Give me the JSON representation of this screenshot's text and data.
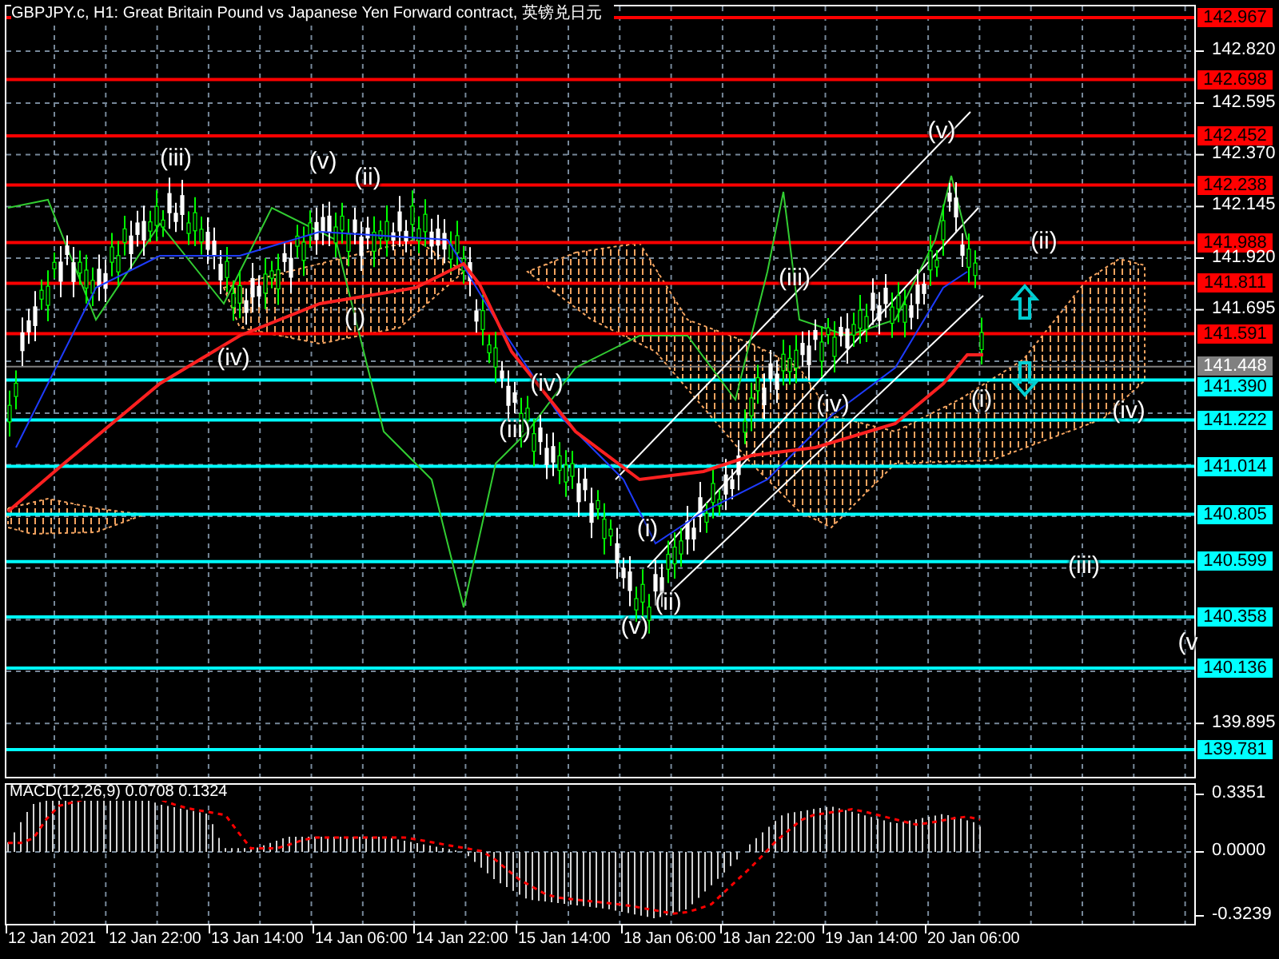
{
  "title": "GBPJPY.c, H1:  Great Britain Pound vs Japanese Yen Forward contract, 英镑兑日元",
  "levels": [
    {
      "price": "142.967",
      "kind": "resistance"
    },
    {
      "price": "142.698",
      "kind": "resistance"
    },
    {
      "price": "142.452",
      "kind": "resistance"
    },
    {
      "price": "142.238",
      "kind": "resistance"
    },
    {
      "price": "141.988",
      "kind": "resistance"
    },
    {
      "price": "141.811",
      "kind": "resistance"
    },
    {
      "price": "141.591",
      "kind": "resistance"
    },
    {
      "price": "141.448",
      "kind": "current"
    },
    {
      "price": "141.390",
      "kind": "support"
    },
    {
      "price": "141.222",
      "kind": "support"
    },
    {
      "price": "141.014",
      "kind": "support"
    },
    {
      "price": "140.805",
      "kind": "support"
    },
    {
      "price": "140.599",
      "kind": "support"
    },
    {
      "price": "140.358",
      "kind": "support"
    },
    {
      "price": "140.136",
      "kind": "support"
    },
    {
      "price": "139.781",
      "kind": "support"
    }
  ],
  "price_ticks": [
    "142.820",
    "142.595",
    "142.370",
    "142.145",
    "141.920",
    "141.695",
    "139.895"
  ],
  "wave_labels": [
    "(iii)",
    "(v)",
    "(ii)",
    "(iv)",
    "(i)",
    "(iv)",
    "(iii)",
    "(i)",
    "(v)",
    "(ii)",
    "(iii)",
    "(iv)",
    "(v)",
    "(ii)",
    "(i)",
    "(iv)",
    "(iii)",
    "(v"
  ],
  "macd": {
    "label": "MACD(12,26,9) 0.0708 0.1324",
    "axis": [
      "0.3351",
      "0.0000",
      "-0.3239"
    ]
  },
  "time_labels": [
    "12 Jan 2021",
    "12 Jan 22:00",
    "13 Jan 14:00",
    "14 Jan 06:00",
    "14 Jan 22:00",
    "15 Jan 14:00",
    "18 Jan 06:00",
    "18 Jan 22:00",
    "19 Jan 14:00",
    "20 Jan 06:00"
  ]
}
